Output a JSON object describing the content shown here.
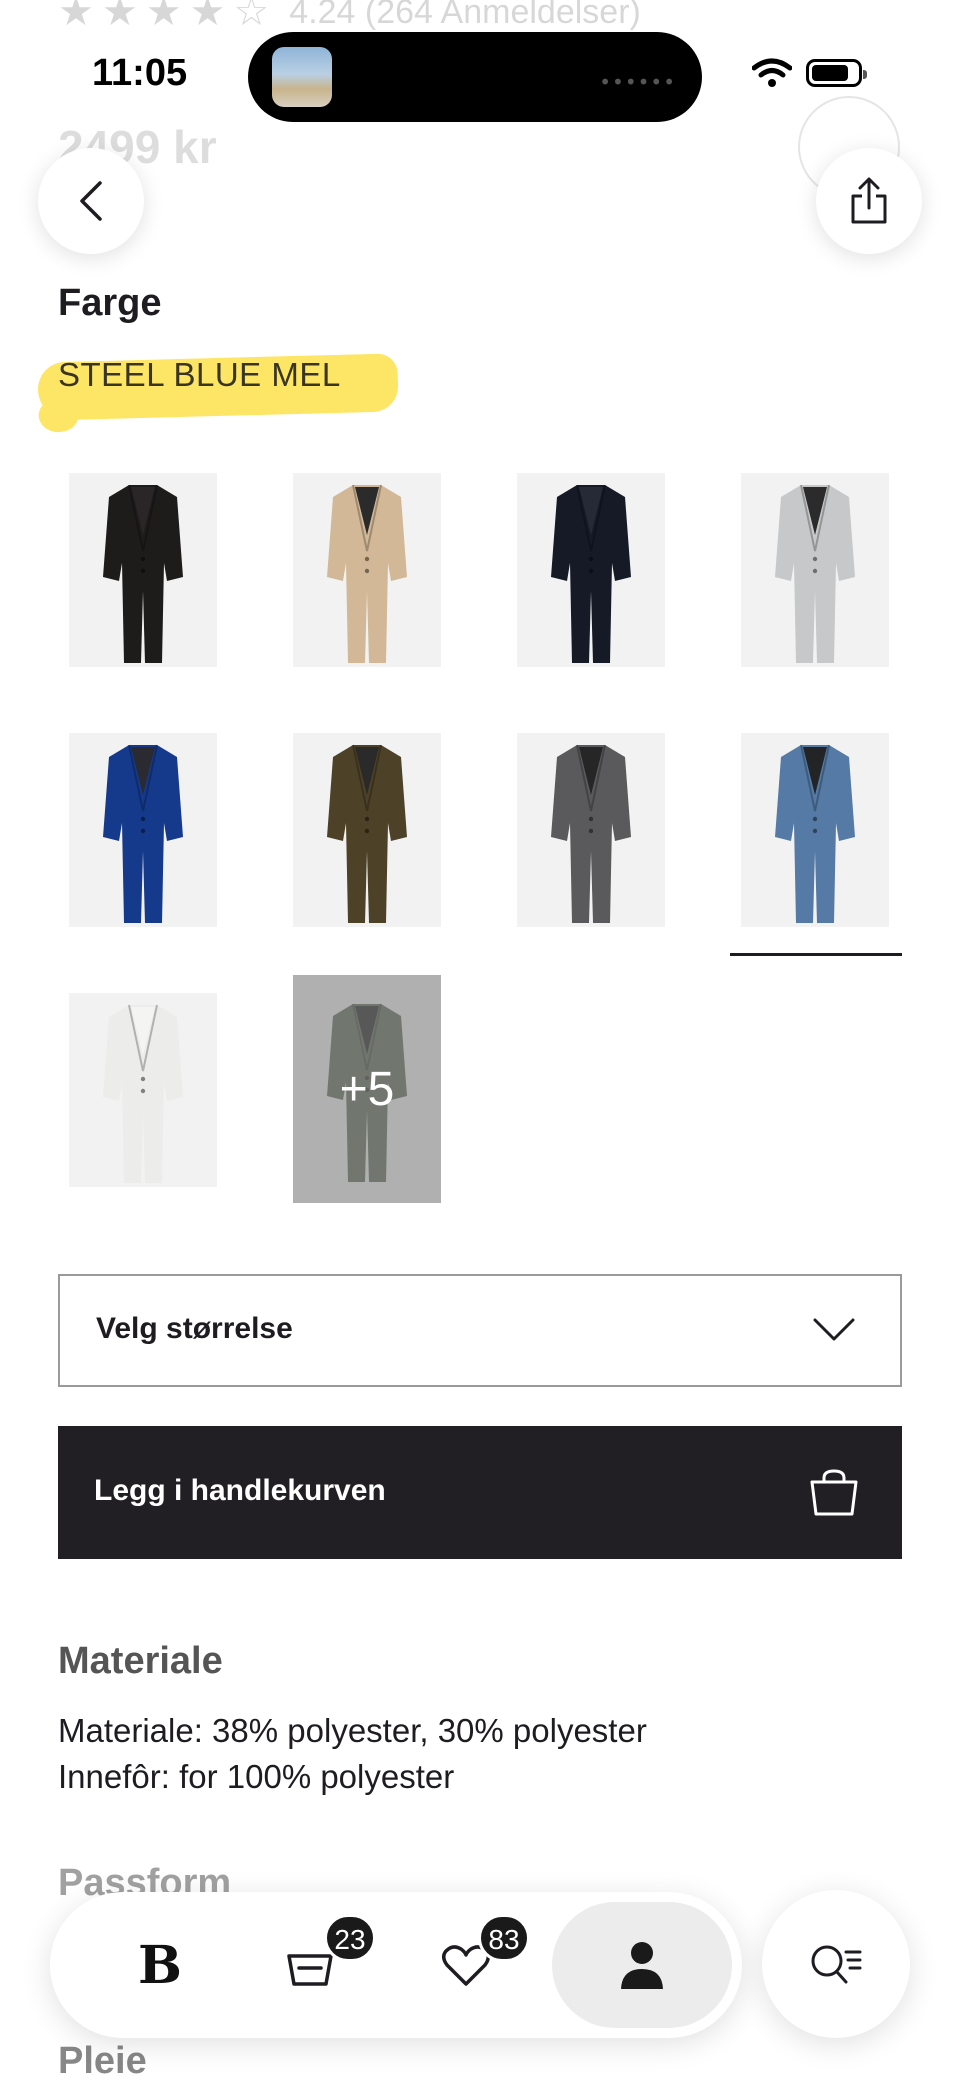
{
  "ghost_header": {
    "rating_text": "4.24 (264 Anmeldelser)",
    "price": "2499 kr"
  },
  "status_bar": {
    "time": "11:05"
  },
  "product": {
    "color_heading": "Farge",
    "selected_color": "STEEL BLUE MEL",
    "more_colors_label": "+5",
    "size_select": {
      "placeholder": "Velg størrelse"
    },
    "add_to_cart_label": "Legg i handlekurven"
  },
  "swatches": [
    {
      "color": "#1e1b1b",
      "shirt": "#2a2628",
      "selected": false
    },
    {
      "color": "#d2b896",
      "shirt": "#2b2b2b",
      "selected": false
    },
    {
      "color": "#161a27",
      "shirt": "#252a36",
      "selected": false
    },
    {
      "color": "#c6c8c9",
      "shirt": "#2b2b2b",
      "selected": false
    },
    {
      "color": "#153a8c",
      "shirt": "#2a2a30",
      "selected": false
    },
    {
      "color": "#4d4228",
      "shirt": "#2a2a2a",
      "selected": false
    },
    {
      "color": "#5a5a5c",
      "shirt": "#262626",
      "selected": false
    },
    {
      "color": "#557aa5",
      "shirt": "#222426",
      "selected": true
    },
    {
      "color": "#ececea",
      "shirt": "#f4f4f2",
      "selected": false
    },
    {
      "color": "#5e6b5a",
      "shirt": "#1f2220",
      "selected": false
    }
  ],
  "materiale": {
    "heading": "Materiale",
    "line1": "Materiale: 38% polyester, 30% polyester",
    "line2": "Innefôr: for 100% polyester"
  },
  "passform_heading": "Passform",
  "pleie_heading": "Pleie",
  "tabbar": {
    "cart_badge": "23",
    "wishlist_badge": "83",
    "brand_letter": "B"
  },
  "colors": {
    "dark": "#221f24",
    "highlight": "#fde566"
  }
}
